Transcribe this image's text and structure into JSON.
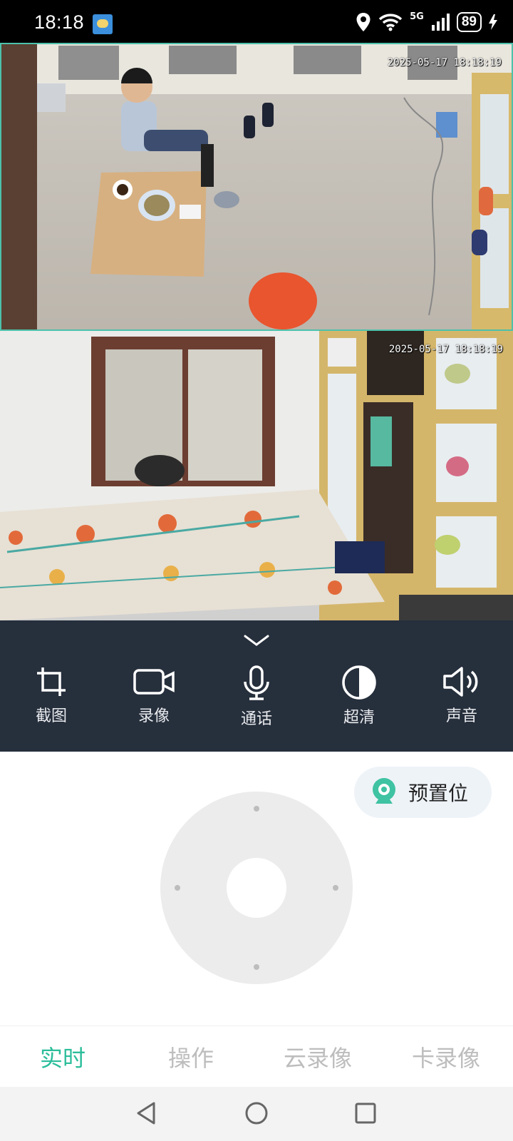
{
  "status_bar": {
    "time": "18:18",
    "network": "5G",
    "battery": "89",
    "icons": [
      "weather-icon",
      "location-icon",
      "wifi-icon",
      "signal-icon",
      "battery-icon",
      "charging-icon"
    ]
  },
  "feeds": [
    {
      "timestamp": "2025-05-17 18:18:19"
    },
    {
      "timestamp": "2025-05-17 18:18:19"
    }
  ],
  "controls": {
    "screenshot_label": "截图",
    "record_label": "录像",
    "talk_label": "通话",
    "quality_label": "超清",
    "sound_label": "声音"
  },
  "preset": {
    "label": "预置位"
  },
  "tabs": [
    {
      "label": "实时",
      "active": true
    },
    {
      "label": "操作",
      "active": false
    },
    {
      "label": "云录像",
      "active": false
    },
    {
      "label": "卡录像",
      "active": false
    }
  ],
  "colors": {
    "accent": "#2bbd9a",
    "panel": "#262f3c",
    "selected_border": "#4cc1ab"
  }
}
